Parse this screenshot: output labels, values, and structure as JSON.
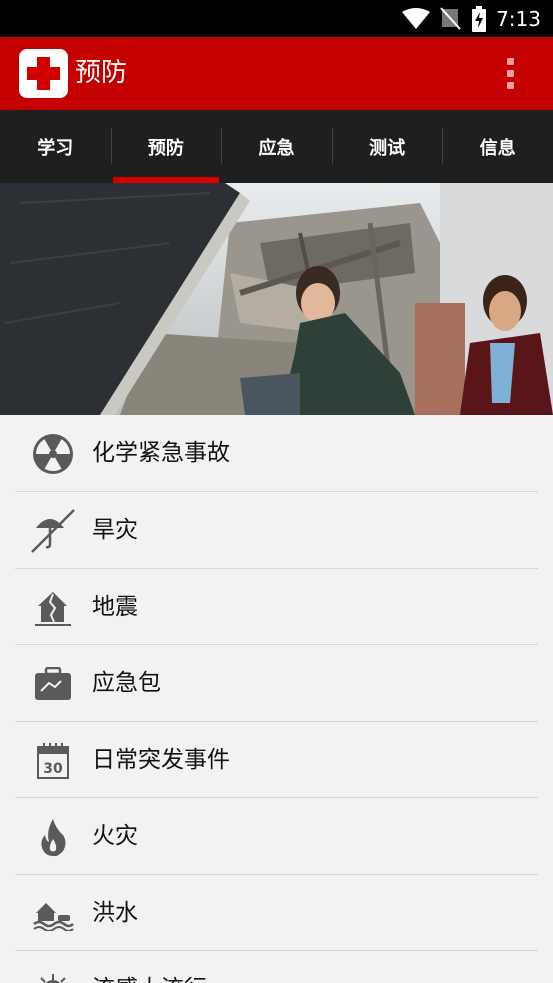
{
  "status_bar": {
    "time": "7:13"
  },
  "app_bar": {
    "title": "预防"
  },
  "tabs": [
    {
      "label": "学习",
      "active": false
    },
    {
      "label": "预防",
      "active": true
    },
    {
      "label": "应急",
      "active": false
    },
    {
      "label": "测试",
      "active": false
    },
    {
      "label": "信息",
      "active": false
    }
  ],
  "hero_image": {
    "icon": "earthquake-survivors-photo"
  },
  "list": [
    {
      "label": "化学紧急事故",
      "icon": "radiation-icon"
    },
    {
      "label": "旱灾",
      "icon": "drought-umbrella-icon"
    },
    {
      "label": "地震",
      "icon": "earthquake-house-icon"
    },
    {
      "label": "应急包",
      "icon": "emergency-kit-icon"
    },
    {
      "label": "日常突发事件",
      "icon": "calendar-30-icon"
    },
    {
      "label": "火灾",
      "icon": "fire-icon"
    },
    {
      "label": "洪水",
      "icon": "flood-icon"
    },
    {
      "label": "流感大流行",
      "icon": "virus-icon"
    }
  ],
  "colors": {
    "accent": "#c40000",
    "tab_bar": "#1f1f1f",
    "icon": "#555555"
  }
}
